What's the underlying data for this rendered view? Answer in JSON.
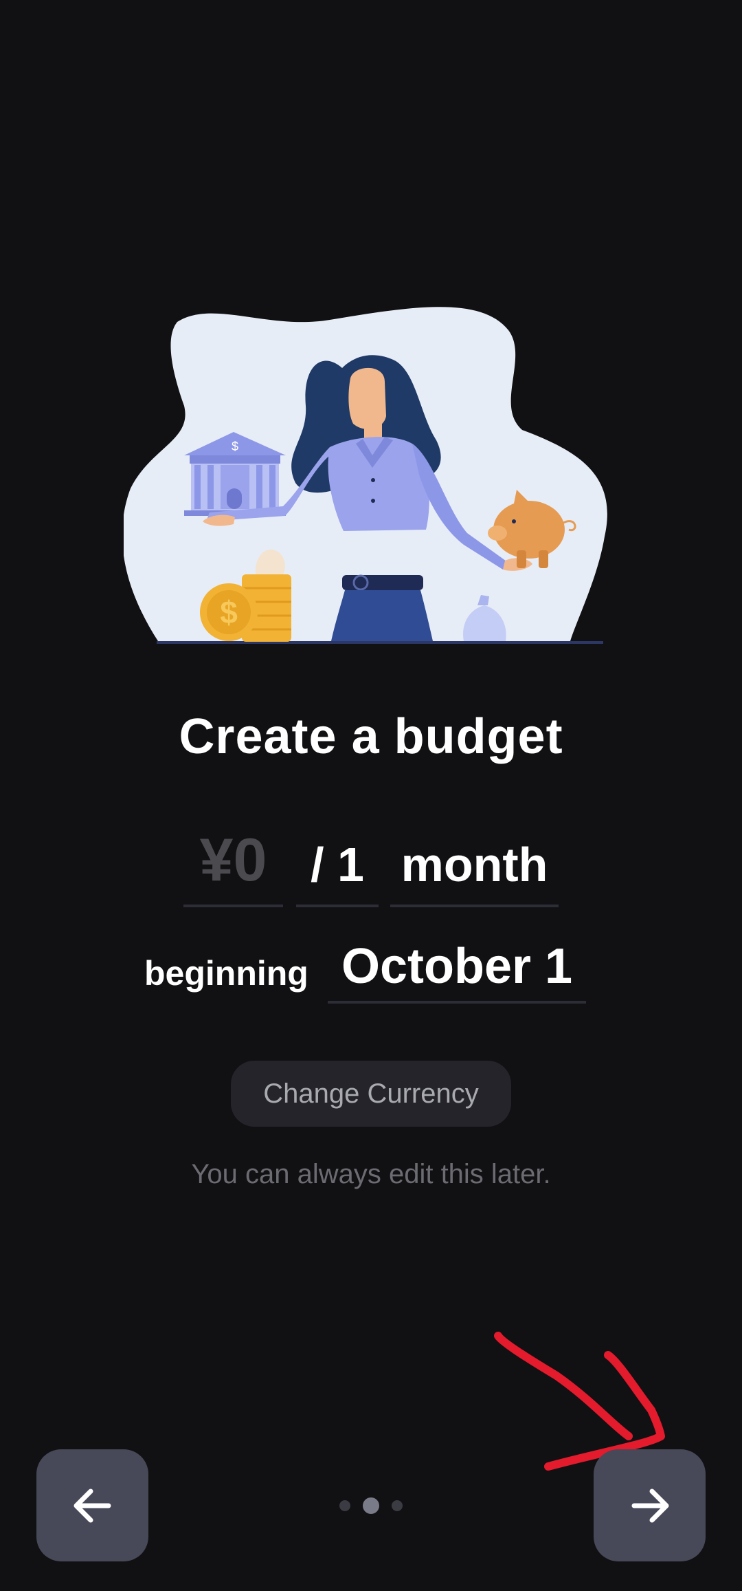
{
  "screen": {
    "title": "Create a budget",
    "amount_value": "¥0",
    "period_count": "/ 1",
    "period_unit": "month",
    "beginning_label": "beginning",
    "start_date": "October 1",
    "change_currency_label": "Change Currency",
    "hint_text": "You can always edit this later."
  },
  "navigation": {
    "back_icon": "arrow-left-icon",
    "next_icon": "arrow-right-icon",
    "page_count": 3,
    "active_page": 2
  },
  "colors": {
    "background": "#111113",
    "button_background": "#474858",
    "currency_button_background": "#24242a",
    "placeholder_text": "#4a4a4f",
    "annotation_red": "#e31b2d"
  }
}
